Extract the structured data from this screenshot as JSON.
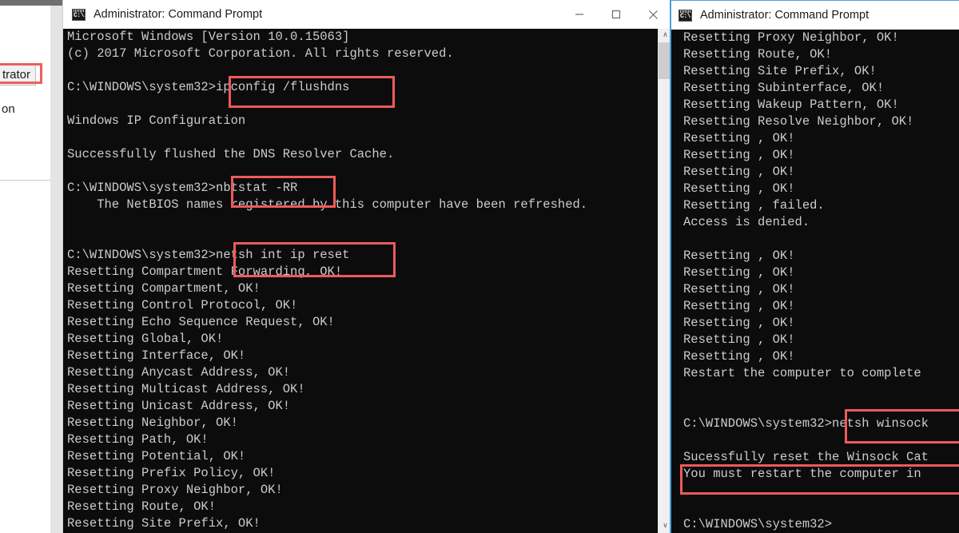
{
  "background_window": {
    "name": "partial-background-window",
    "items": [
      {
        "label": "trator",
        "highlighted": true
      },
      {
        "label": "on",
        "highlighted": false
      }
    ]
  },
  "left_window": {
    "title": "Administrator: Command Prompt",
    "icon": "command-prompt-icon",
    "controls": {
      "minimize": "–",
      "maximize": "□",
      "close": "✕"
    },
    "scrollbar": {
      "up_arrow": "∧",
      "down_arrow": "∨"
    },
    "lines": [
      "Microsoft Windows [Version 10.0.15063]",
      "(c) 2017 Microsoft Corporation. All rights reserved.",
      "",
      "C:\\WINDOWS\\system32>ipconfig /flushdns",
      "",
      "Windows IP Configuration",
      "",
      "Successfully flushed the DNS Resolver Cache.",
      "",
      "C:\\WINDOWS\\system32>nbtstat -RR",
      "    The NetBIOS names registered by this computer have been refreshed.",
      "",
      "",
      "C:\\WINDOWS\\system32>netsh int ip reset",
      "Resetting Compartment Forwarding, OK!",
      "Resetting Compartment, OK!",
      "Resetting Control Protocol, OK!",
      "Resetting Echo Sequence Request, OK!",
      "Resetting Global, OK!",
      "Resetting Interface, OK!",
      "Resetting Anycast Address, OK!",
      "Resetting Multicast Address, OK!",
      "Resetting Unicast Address, OK!",
      "Resetting Neighbor, OK!",
      "Resetting Path, OK!",
      "Resetting Potential, OK!",
      "Resetting Prefix Policy, OK!",
      "Resetting Proxy Neighbor, OK!",
      "Resetting Route, OK!",
      "Resetting Site Prefix, OK!"
    ]
  },
  "right_window": {
    "title": "Administrator: Command Prompt",
    "icon": "command-prompt-icon",
    "scrollbar": {
      "up_arrow": "∧",
      "down_arrow": "∨"
    },
    "lines": [
      "Resetting Proxy Neighbor, OK!",
      "Resetting Route, OK!",
      "Resetting Site Prefix, OK!",
      "Resetting Subinterface, OK!",
      "Resetting Wakeup Pattern, OK!",
      "Resetting Resolve Neighbor, OK!",
      "Resetting , OK!",
      "Resetting , OK!",
      "Resetting , OK!",
      "Resetting , OK!",
      "Resetting , failed.",
      "Access is denied.",
      "",
      "Resetting , OK!",
      "Resetting , OK!",
      "Resetting , OK!",
      "Resetting , OK!",
      "Resetting , OK!",
      "Resetting , OK!",
      "Resetting , OK!",
      "Restart the computer to complete",
      "",
      "",
      "C:\\WINDOWS\\system32>netsh winsock",
      "",
      "Sucessfully reset the Winsock Cat",
      "You must restart the computer in",
      "",
      "",
      "C:\\WINDOWS\\system32>"
    ]
  },
  "annotations": {
    "accent_color": "#ee5a5a",
    "boxes": [
      {
        "name": "highlight-ipconfig-flushdns",
        "label": "ipconfig /flushdns"
      },
      {
        "name": "highlight-nbtstat-rr",
        "label": "nbtstat -RR"
      },
      {
        "name": "highlight-netsh-int-ip-reset",
        "label": "netsh int ip reset"
      },
      {
        "name": "highlight-netsh-winsock",
        "label": "netsh winsock"
      },
      {
        "name": "highlight-must-restart",
        "label": "You must restart the computer in"
      },
      {
        "name": "highlight-background-menu-item",
        "label": "trator"
      }
    ]
  },
  "theme": {
    "console_bg": "#0c0c0c",
    "console_fg": "#cccccc",
    "titlebar_bg": "#ffffff",
    "titlebar_fg": "#1b1b1b",
    "focus_border": "#4a9fd8"
  }
}
